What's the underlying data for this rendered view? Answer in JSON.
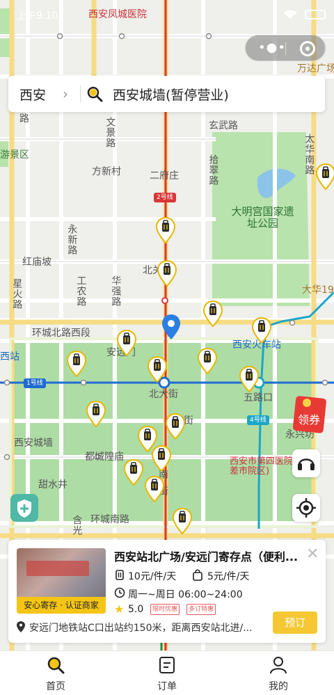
{
  "status_bar": {
    "time": "上午9:10"
  },
  "map": {
    "labels": {
      "hospital_top": "西安凤城医院",
      "wanda": "万达广场",
      "xuanwu_rd": "玄武路",
      "wenjing_rd": "文景路",
      "fangxin_village": "方新村",
      "erfu_zhuang": "二府庄",
      "line2": "2号线",
      "shicui_rd": "拾翠路",
      "taihua_rd": "太华南路",
      "daming_palace": "大明宫国家遗址公园",
      "yongxin_rd": "永新路",
      "honghumiao_po": "红庙坡",
      "xinghuo_rd": "星火路",
      "gongnong_rd": "工农路",
      "huaqiang_rd": "华强路",
      "beiguan": "北关",
      "dahua": "大华19",
      "huancheng_north_west": "环城北路西段",
      "xian_railway": "西安火车站",
      "anyuan_gate": "安远门",
      "xi_station": "西站",
      "line1": "1号线",
      "beidajie": "北大街",
      "wulukou": "五路口",
      "line4": "4号线",
      "xian_city_wall": "西安城墙",
      "ducheng_temple": "都城隍庙",
      "xian_4th_hospital": "西安市第四医院(大差市院区)",
      "yongxing_fang": "永兴坊",
      "tianshui_well": "甜水井",
      "nan": "南",
      "jie": "街",
      "huancheng_south": "环城南路",
      "hanguang": "含光",
      "youyou_scenic": "游景区",
      "road_lu": "路",
      "road_jie": "街"
    }
  },
  "search": {
    "city": "西安",
    "query": "西安城墙(暂停营业)"
  },
  "coupon_label": "领券",
  "card": {
    "title": "西安站北广场/安远门寄存点（便利...",
    "photo_badge": "安心寄存 · 认证商家",
    "price_small": "10元/件/天",
    "price_bag": "5元/件/天",
    "hours": "周一~周日 06:00~24:00",
    "rating": "5.0",
    "tag1": "限时优惠",
    "tag2": "多订特惠",
    "address": "安远门地铁站C口出站约150米，距离西安站北进/...",
    "book_label": "预订"
  },
  "tabs": [
    {
      "label": "首页",
      "icon": "search-icon"
    },
    {
      "label": "订单",
      "icon": "order-icon"
    },
    {
      "label": "我的",
      "icon": "profile-icon"
    }
  ],
  "colors": {
    "accent": "#f5c515",
    "line1": "#1f6bd1",
    "line2": "#d93636",
    "line4": "#1aa6c6",
    "park": "#a8d9a0"
  }
}
